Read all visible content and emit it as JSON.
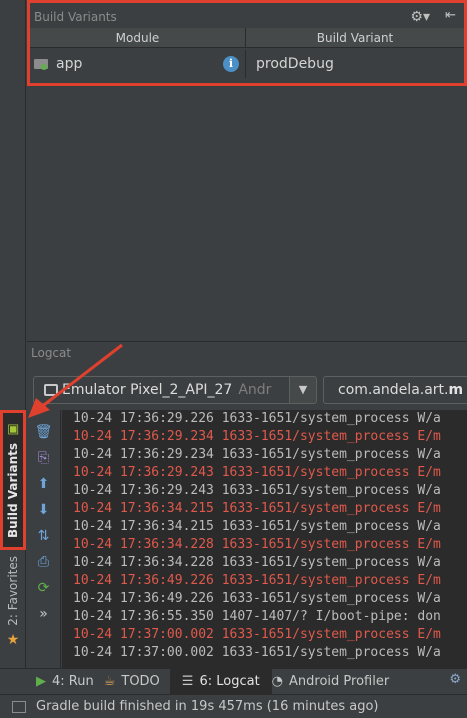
{
  "build_variants": {
    "title": "Build Variants",
    "gear_icon": "⚙▾",
    "hide_icon": "⇤",
    "columns": {
      "module": "Module",
      "variant": "Build Variant"
    },
    "rows": [
      {
        "module": "app",
        "variant": "prodDebug"
      }
    ],
    "info_icon": "i"
  },
  "left_strip": {
    "build_variants_label": "Build Variants",
    "favorites_label": "2: Favorites"
  },
  "logcat": {
    "title": "Logcat",
    "device": {
      "name": "Emulator Pixel_2_API_27",
      "suffix": "Andr",
      "arrow": "▼"
    },
    "package": {
      "prefix": "com.andela.art.",
      "bold": "m"
    },
    "lines": [
      {
        "text": "10-24 17:36:29.226 1633-1651/system_process W/a",
        "level": "w"
      },
      {
        "text": "10-24 17:36:29.234 1633-1651/system_process E/m",
        "level": "e"
      },
      {
        "text": "10-24 17:36:29.234 1633-1651/system_process W/a",
        "level": "w"
      },
      {
        "text": "10-24 17:36:29.243 1633-1651/system_process E/m",
        "level": "e"
      },
      {
        "text": "10-24 17:36:29.243 1633-1651/system_process W/a",
        "level": "w"
      },
      {
        "text": "10-24 17:36:34.215 1633-1651/system_process E/m",
        "level": "e"
      },
      {
        "text": "10-24 17:36:34.215 1633-1651/system_process W/a",
        "level": "w"
      },
      {
        "text": "10-24 17:36:34.228 1633-1651/system_process E/m",
        "level": "e"
      },
      {
        "text": "10-24 17:36:34.228 1633-1651/system_process W/a",
        "level": "w"
      },
      {
        "text": "10-24 17:36:49.226 1633-1651/system_process E/m",
        "level": "e"
      },
      {
        "text": "10-24 17:36:49.226 1633-1651/system_process W/a",
        "level": "w"
      },
      {
        "text": "10-24 17:36:55.350 1407-1407/? I/boot-pipe: don",
        "level": "w"
      },
      {
        "text": "10-24 17:37:00.002 1633-1651/system_process E/m",
        "level": "e"
      },
      {
        "text": "10-24 17:37:00.002 1633-1651/system_process W/a",
        "level": "w"
      }
    ],
    "tools": [
      "🗑",
      "⎘",
      "⬆",
      "⬇",
      "⇅",
      "⎙",
      "⟳",
      "»"
    ]
  },
  "bottom_tabs": [
    {
      "icon": "▶",
      "label": "4: Run",
      "active": false
    },
    {
      "icon": "☕",
      "label": "TODO",
      "active": false
    },
    {
      "icon": "☰",
      "label": "6: Logcat",
      "active": true
    },
    {
      "icon": "◔",
      "label": "Android Profiler",
      "active": false
    }
  ],
  "bottom_settings_icon": "⚙",
  "status": {
    "text": "Gradle build finished in 19s 457ms (16 minutes ago)"
  },
  "colors": {
    "highlight": "#e0402e",
    "error": "#e0594c",
    "background": "#3c3f41",
    "console": "#2b2b2b"
  }
}
